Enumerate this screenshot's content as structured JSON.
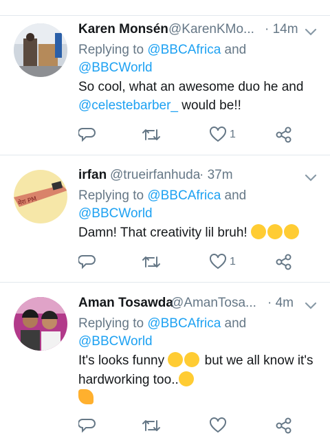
{
  "tweets": [
    {
      "name": "Karen Monsén",
      "handle": "@KarenKMo...",
      "time": "· 14m",
      "replying_prefix": "Replying to ",
      "replying_to_1": "@BBCAfrica",
      "replying_and": " and",
      "replying_to_2": "@BBCWorld",
      "text_line1": "So cool, what an awesome duo he and",
      "mention": "@celestebarber_",
      "text_line2_rest": " would be!!",
      "like_count": "1"
    },
    {
      "name": "irfan",
      "handle": "@trueirfanhuda",
      "time": "· 37m",
      "replying_prefix": "Replying to ",
      "replying_to_1": "@BBCAfrica",
      "replying_and": " and",
      "replying_to_2": "@BBCWorld",
      "text_line1": "Damn!  That creativity lil bruh! ",
      "like_count": "1"
    },
    {
      "name": "Aman Tosawda",
      "handle": "@AmanTosa...",
      "time": "· 4m",
      "replying_prefix": "Replying to ",
      "replying_to_1": "@BBCAfrica",
      "replying_and": " and",
      "replying_to_2": "@BBCWorld",
      "text_line1a": "It's looks funny ",
      "text_line1b": " but we all know it's",
      "text_line2": "hardworking too.."
    }
  ],
  "icons": {
    "reply": "reply-icon",
    "retweet": "retweet-icon",
    "like": "heart-icon",
    "share": "share-icon",
    "more": "chevron-down-icon"
  },
  "colors": {
    "link": "#1da1f2",
    "muted": "#657786",
    "emoji": "#ffcc33"
  }
}
